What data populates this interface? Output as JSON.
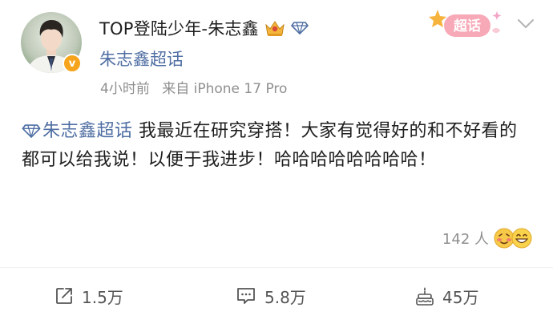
{
  "post": {
    "author": {
      "name": "TOP登陆少年-朱志鑫",
      "supertopic": "朱志鑫超话"
    },
    "meta": {
      "time": "4小时前",
      "source": "来自 iPhone 17 Pro"
    },
    "supertopic_badge": "超话",
    "topic_tag": "朱志鑫超话",
    "body": " 我最近在研究穿搭！大家有觉得好的和不好看的都可以给我说！以便于我进步！哈哈哈哈哈哈哈哈！",
    "views": "142 人",
    "actions": {
      "forward": "1.5万",
      "comment": "5.8万",
      "like": "45万"
    }
  },
  "colors": {
    "link": "#4f6ea3",
    "text": "#1e1e1e",
    "muted": "#8f8f8f",
    "verified": "#f6a41c"
  }
}
